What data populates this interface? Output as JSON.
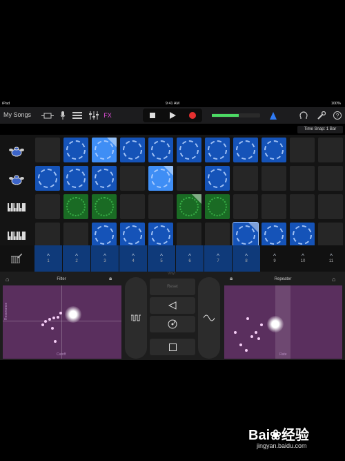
{
  "status_bar": {
    "device": "iPad",
    "time": "9:41 AM",
    "battery": "100%"
  },
  "toolbar": {
    "my_songs_label": "My Songs",
    "fx_label": "FX",
    "meter_level": 0.55,
    "icons": [
      "browser-icon",
      "mic-icon",
      "tracks-view-icon",
      "mixer-icon",
      "fx-icon",
      "stop-icon",
      "play-icon",
      "record-icon",
      "metronome-icon",
      "loops-icon",
      "settings-icon",
      "help-icon"
    ]
  },
  "tooltip": "Time Snap: 1 Bar",
  "tracks": [
    {
      "name": "drums-1",
      "icon": "drum-kit-icon",
      "cells": [
        "empty",
        "blue",
        "bright",
        "blue",
        "blue",
        "blue",
        "blue",
        "blue",
        "blue",
        "empty",
        "empty"
      ],
      "progress": [
        2
      ]
    },
    {
      "name": "drums-2",
      "icon": "drum-kit-icon",
      "cells": [
        "blue",
        "blue",
        "blue",
        "empty",
        "bright",
        "empty",
        "blue",
        "empty",
        "empty",
        "empty",
        "empty"
      ],
      "progress": [
        4
      ]
    },
    {
      "name": "keyboard-1",
      "icon": "keyboard-icon",
      "cells": [
        "empty",
        "green",
        "green",
        "empty",
        "empty",
        "green",
        "green",
        "empty",
        "empty",
        "empty",
        "empty"
      ],
      "progress": [
        5
      ]
    },
    {
      "name": "keyboard-2",
      "icon": "keyboard-icon",
      "cells": [
        "empty",
        "empty",
        "blue",
        "blue",
        "blue",
        "empty",
        "empty",
        "blue",
        "blue",
        "blue",
        "empty"
      ],
      "progress": [
        7
      ]
    }
  ],
  "column_triggers": [
    "1",
    "2",
    "3",
    "4",
    "5",
    "6",
    "7",
    "8",
    "9",
    "10",
    "11"
  ],
  "active_triggers": 8,
  "fx": {
    "left_pad": {
      "title": "Filter",
      "y_axis": "Resonance",
      "x_axis": "Cutoff"
    },
    "right_pad": {
      "title": "Repeater",
      "y_axis": "",
      "x_axis": "Rate"
    },
    "center": {
      "top_button": "Reset",
      "top_mini_label": "Vinyl",
      "reverse_icon": "reverse-icon",
      "scratch_icon": "turntable-icon",
      "stop_icon": "stop-icon",
      "left_pill_icon": "gate-icon",
      "right_pill_icon": "wave-icon"
    }
  },
  "watermark": {
    "brand": "Bai",
    "brand2": "经验",
    "url": "jingyan.baidu.com"
  },
  "colors": {
    "clip_blue": "#1553b8",
    "clip_green": "#1a6b24",
    "pad_purple": "#5a2f5e",
    "accent_record": "#e53030"
  }
}
